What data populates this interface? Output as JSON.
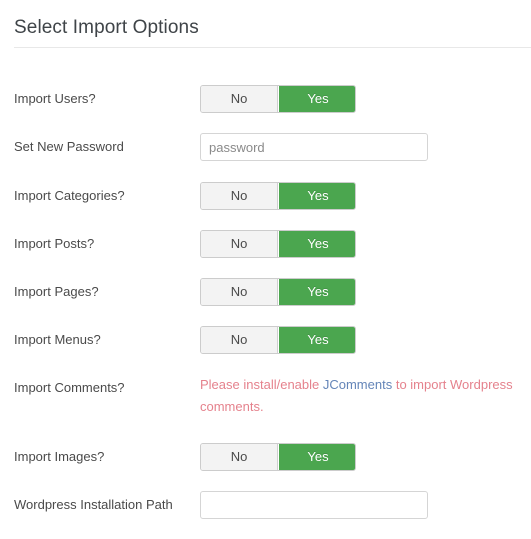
{
  "panel": {
    "title": "Select Import Options"
  },
  "toggle": {
    "off_label": "No",
    "on_label": "Yes"
  },
  "colors": {
    "toggle_on_green": "#4ba64f",
    "toggle_off_gray": "#f3f3f3",
    "notice_red": "#e5828d",
    "link_blue": "#6485b8",
    "label_text": "#4a4a4a",
    "title_text": "#3f4448"
  },
  "rows": [
    {
      "name": "import-users",
      "label": "Import Users?",
      "type": "toggle",
      "value": "Yes"
    },
    {
      "name": "set-new-password",
      "label": "Set New Password",
      "type": "input",
      "value": "",
      "placeholder": "password"
    },
    {
      "name": "import-categories",
      "label": "Import Categories?",
      "type": "toggle",
      "value": "Yes"
    },
    {
      "name": "import-posts",
      "label": "Import Posts?",
      "type": "toggle",
      "value": "Yes"
    },
    {
      "name": "import-pages",
      "label": "Import Pages?",
      "type": "toggle",
      "value": "Yes"
    },
    {
      "name": "import-menus",
      "label": "Import Menus?",
      "type": "toggle",
      "value": "Yes"
    },
    {
      "name": "import-comments",
      "label": "Import Comments?",
      "type": "notice",
      "notice_prefix": "Please install/enable ",
      "notice_link": "JComments",
      "notice_suffix": " to import Wordpress comments."
    },
    {
      "name": "import-images",
      "label": "Import Images?",
      "type": "toggle",
      "value": "Yes"
    },
    {
      "name": "wordpress-installation-path",
      "label": "Wordpress Installation Path",
      "type": "input",
      "value": "",
      "placeholder": ""
    }
  ]
}
